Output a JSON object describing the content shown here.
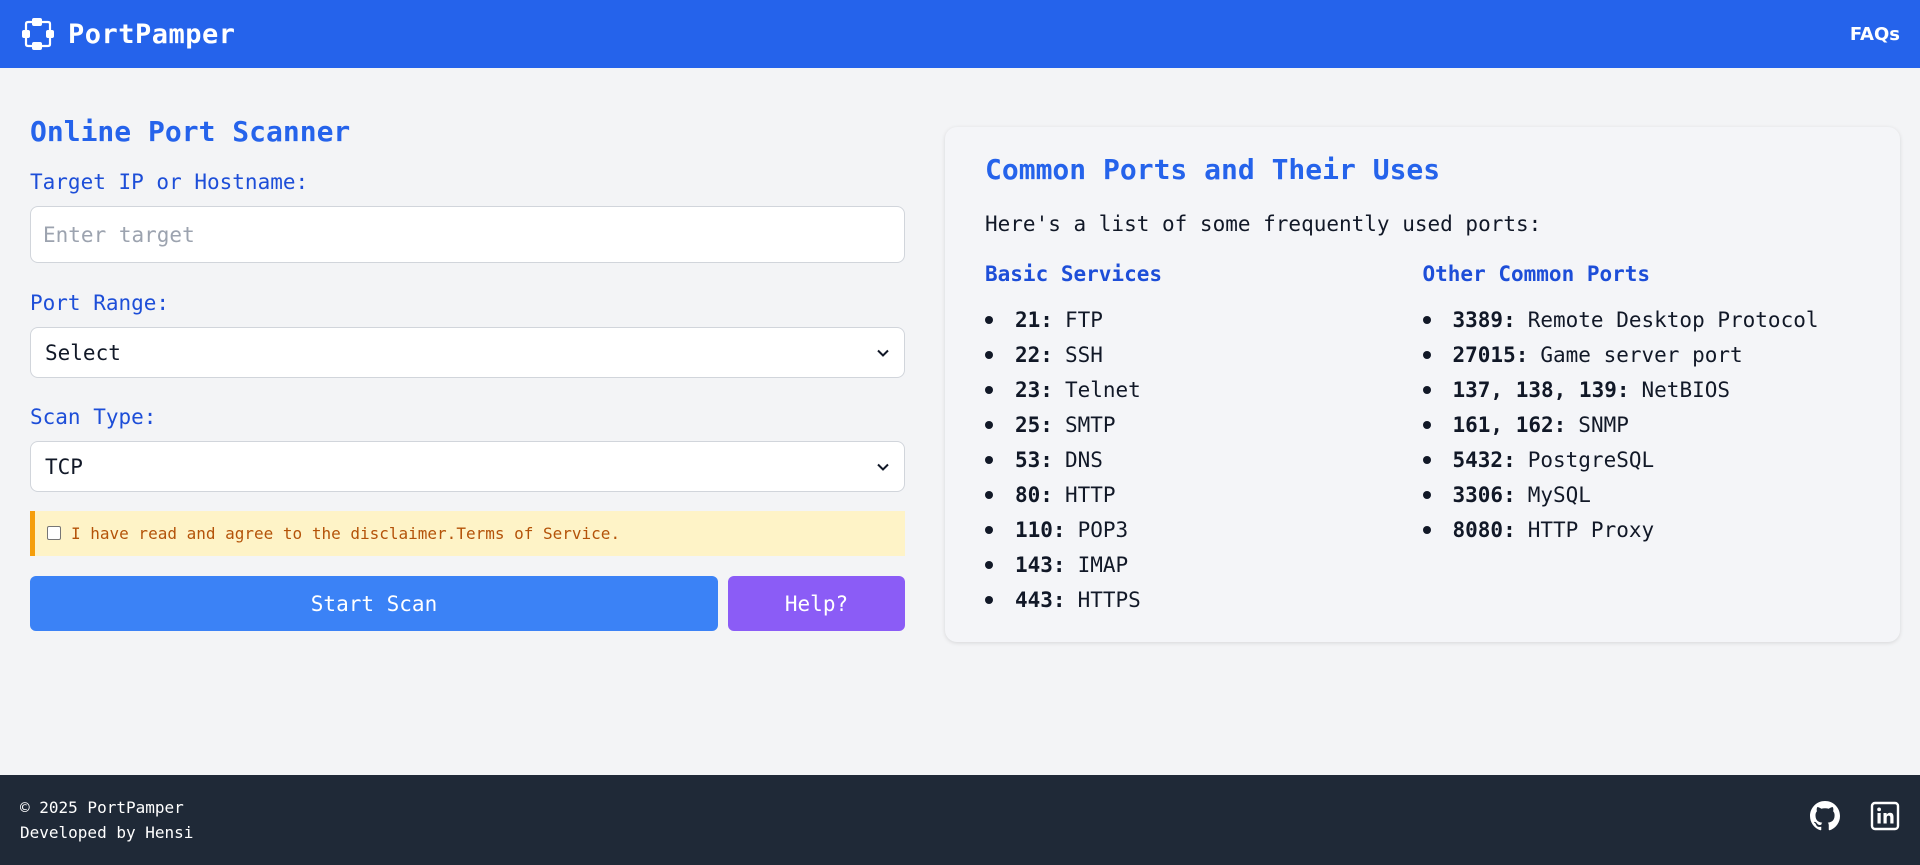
{
  "header": {
    "brand": "PortPamper",
    "nav_faq": "FAQs"
  },
  "scanner": {
    "title": "Online Port Scanner",
    "target_label": "Target IP or Hostname:",
    "target_placeholder": "Enter target",
    "target_value": "",
    "port_range_label": "Port Range:",
    "port_range_selected": "Select",
    "scan_type_label": "Scan Type:",
    "scan_type_selected": "TCP",
    "disclaimer": "I have read and agree to the disclaimer.Terms of Service.",
    "disclaimer_checked": false,
    "start_scan": "Start Scan",
    "help": "Help?"
  },
  "ports": {
    "title": "Common Ports and Their Uses",
    "intro": "Here's a list of some frequently used ports:",
    "basic": {
      "title": "Basic Services",
      "items": [
        {
          "port": "21:",
          "name": "FTP"
        },
        {
          "port": "22:",
          "name": "SSH"
        },
        {
          "port": "23:",
          "name": "Telnet"
        },
        {
          "port": "25:",
          "name": "SMTP"
        },
        {
          "port": "53:",
          "name": "DNS"
        },
        {
          "port": "80:",
          "name": "HTTP"
        },
        {
          "port": "110:",
          "name": "POP3"
        },
        {
          "port": "143:",
          "name": "IMAP"
        },
        {
          "port": "443:",
          "name": "HTTPS"
        }
      ]
    },
    "other": {
      "title": "Other Common Ports",
      "items": [
        {
          "port": "3389:",
          "name": "Remote Desktop Protocol"
        },
        {
          "port": "27015:",
          "name": "Game server port"
        },
        {
          "port": "137, 138, 139:",
          "name": "NetBIOS"
        },
        {
          "port": "161, 162:",
          "name": "SNMP"
        },
        {
          "port": "5432:",
          "name": "PostgreSQL"
        },
        {
          "port": "3306:",
          "name": "MySQL"
        },
        {
          "port": "8080:",
          "name": "HTTP Proxy"
        }
      ]
    }
  },
  "footer": {
    "copyright": "© 2025 PortPamper",
    "developer": "Developed by Hensi"
  },
  "icons": {
    "logo": "network-logo-icon",
    "github": "github-icon",
    "linkedin": "linkedin-icon"
  },
  "colors": {
    "primary": "#2563eb",
    "scan_button": "#3b82f6",
    "help_button": "#8b5cf6",
    "footer_bg": "#1f2937",
    "disclaimer_bg": "#fef3c7",
    "disclaimer_accent": "#f59e0b"
  }
}
